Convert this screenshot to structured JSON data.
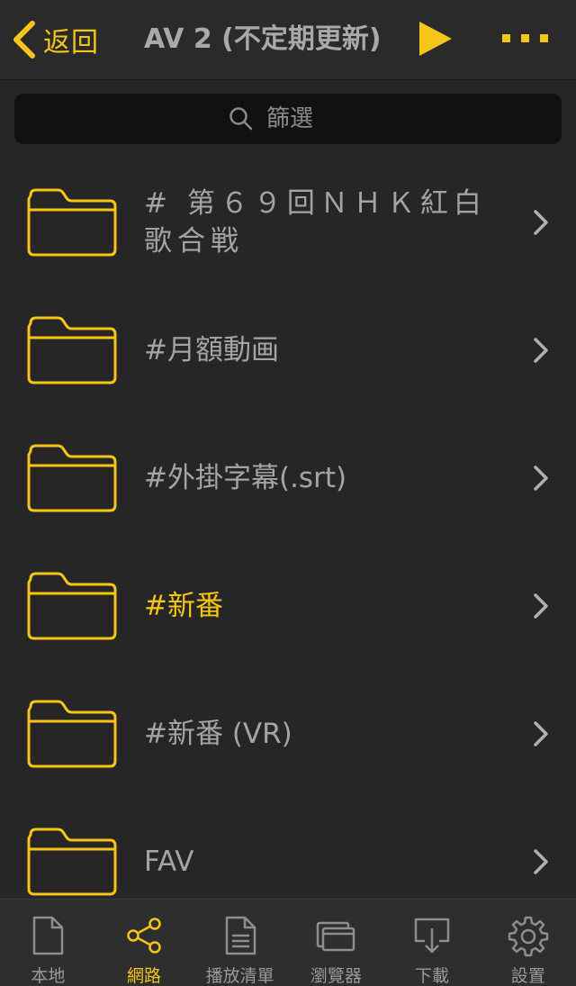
{
  "header": {
    "back_label": "返回",
    "title": "AV 2 (不定期更新)"
  },
  "search": {
    "placeholder": "篩選"
  },
  "colors": {
    "accent": "#f5c518",
    "background": "#262626",
    "text": "#a4a4a4",
    "search_bg": "#111111"
  },
  "folders": [
    {
      "label": "# 第６９回ＮＨＫ紅白歌合戦",
      "active": false
    },
    {
      "label": "#月額動画",
      "active": false
    },
    {
      "label": "#外掛字幕(.srt)",
      "active": false
    },
    {
      "label": "#新番",
      "active": true
    },
    {
      "label": "#新番 (VR)",
      "active": false
    },
    {
      "label": "FAV",
      "active": false
    }
  ],
  "tabs": [
    {
      "label": "本地",
      "icon": "document-icon",
      "active": false
    },
    {
      "label": "網路",
      "icon": "share-icon",
      "active": true
    },
    {
      "label": "播放清單",
      "icon": "playlist-icon",
      "active": false
    },
    {
      "label": "瀏覽器",
      "icon": "browser-icon",
      "active": false
    },
    {
      "label": "下載",
      "icon": "download-icon",
      "active": false
    },
    {
      "label": "設置",
      "icon": "settings-gear-icon",
      "active": false
    }
  ]
}
